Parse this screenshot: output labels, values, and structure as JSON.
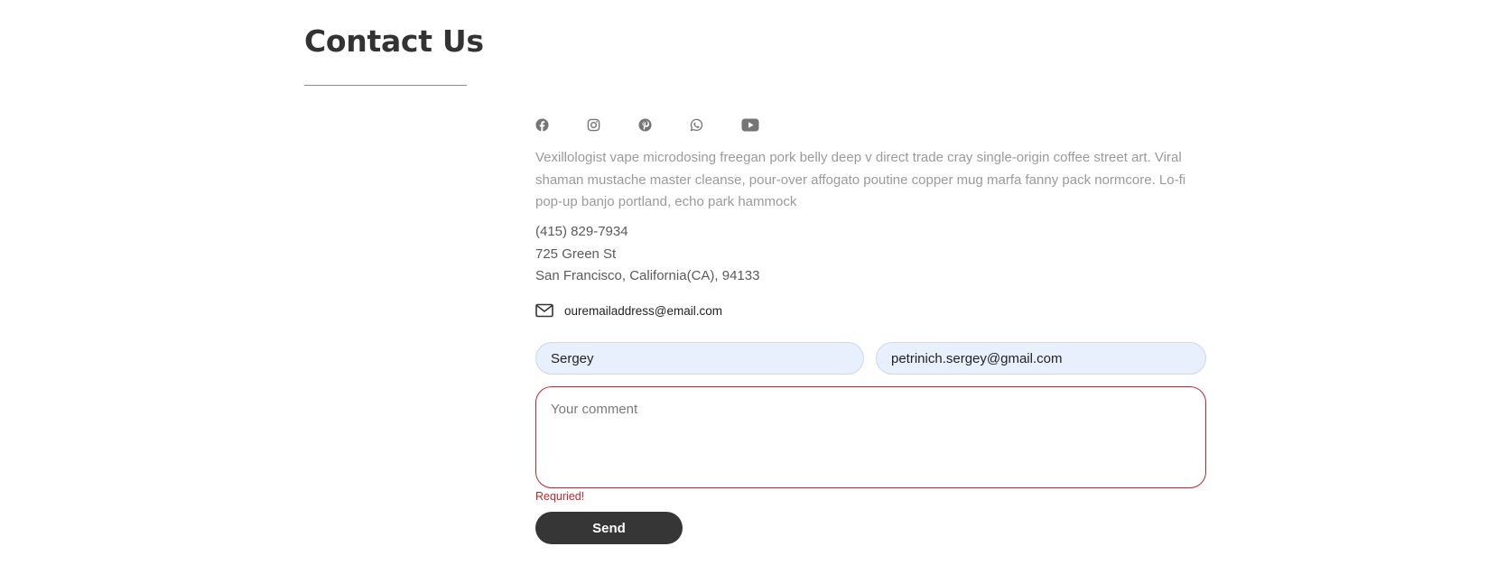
{
  "page": {
    "title": "Contact Us"
  },
  "social": {
    "icons": [
      "facebook-icon",
      "instagram-icon",
      "pinterest-icon",
      "whatsapp-icon",
      "youtube-icon"
    ],
    "icon_color": "#757575"
  },
  "description": "Vexillologist vape microdosing freegan pork belly deep v direct trade cray single-origin coffee street art. Viral shaman mustache master cleanse, pour-over affogato poutine copper mug marfa fanny pack normcore. Lo-fi pop-up banjo portland, echo park hammock",
  "contact": {
    "phone": "(415) 829-7934",
    "street": "725 Green St",
    "city": "San Francisco, California(CA), 94133",
    "email": "ouremailaddress@email.com"
  },
  "form": {
    "name_value": "Sergey",
    "email_value": "petrinich.sergey@gmail.com",
    "comment_placeholder": "Your comment",
    "error_text": "Requried!",
    "send_label": "Send",
    "error_color": "#c0262c",
    "autofill_bg": "#e8f0fe",
    "button_bg": "#363636"
  }
}
